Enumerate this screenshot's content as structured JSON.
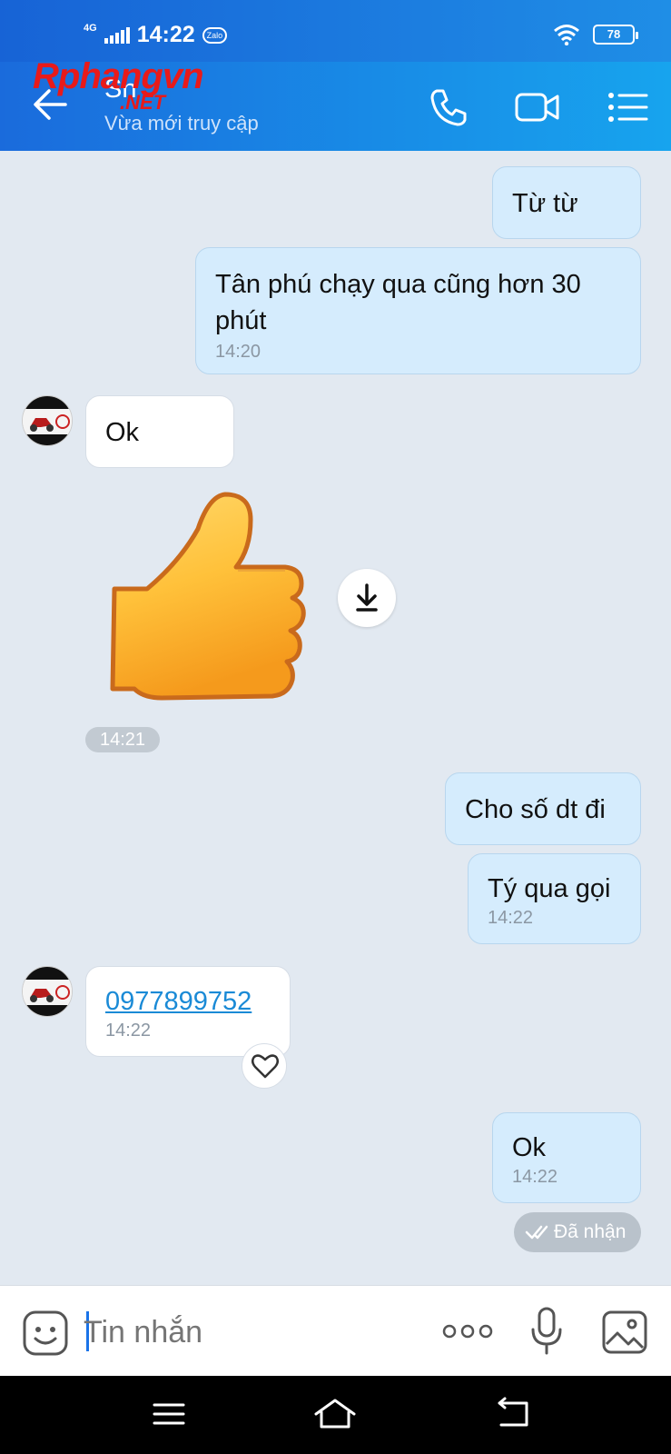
{
  "status_bar": {
    "network": "4G",
    "time": "14:22",
    "app_badge": "Zalo",
    "battery": "78"
  },
  "header": {
    "contact_name": "Sn",
    "contact_status": "Vừa mới truy cập",
    "watermark_main": "Rphangvn",
    "watermark_sub": ".NET"
  },
  "messages": {
    "m1": {
      "text": "Từ từ"
    },
    "m2": {
      "text": "Tân phú chạy qua cũng hơn 30 phút",
      "time": "14:20"
    },
    "m3": {
      "text": "Ok"
    },
    "sticker_time": "14:21",
    "m4": {
      "text": "Cho số dt đi"
    },
    "m5": {
      "text": "Tý qua gọi",
      "time": "14:22"
    },
    "m6": {
      "text": "0977899752",
      "time": "14:22"
    },
    "m7": {
      "text": "Ok",
      "time": "14:22"
    },
    "seen_label": "Đã nhận"
  },
  "input": {
    "placeholder": "Tin nhắn"
  },
  "colors": {
    "header_start": "#1a6bdc",
    "header_end": "#17a4ee",
    "chat_bg": "#e2e9f1",
    "out_bubble": "#d5ecfd",
    "link": "#1a8ad6"
  }
}
